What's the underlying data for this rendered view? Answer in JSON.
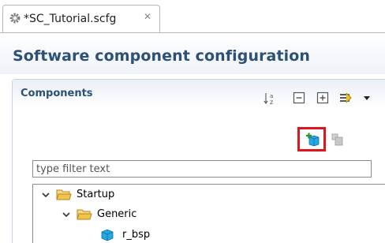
{
  "tab": {
    "title": "*SC_Tutorial.scfg",
    "close_glyph": "✕",
    "icon": "gear-icon"
  },
  "page": {
    "title": "Software component configuration"
  },
  "section": {
    "title": "Components",
    "toolbar": [
      "sort-alpha-icon",
      "collapse-all-icon",
      "expand-all-icon",
      "filter-menu-icon"
    ]
  },
  "actions": {
    "add_icon": "add-component-icon",
    "remove_icon": "remove-component-icon"
  },
  "filter": {
    "placeholder": "type filter text",
    "value": ""
  },
  "tree": {
    "nodes": [
      {
        "label": "Startup",
        "icon": "folder-open-icon",
        "expanded": true
      },
      {
        "label": "Generic",
        "icon": "folder-open-icon",
        "expanded": true
      },
      {
        "label": "r_bsp",
        "icon": "component-icon"
      }
    ]
  },
  "colors": {
    "title": "#2c5078",
    "highlight": "#e0141c",
    "folder": "#e8b83a"
  }
}
